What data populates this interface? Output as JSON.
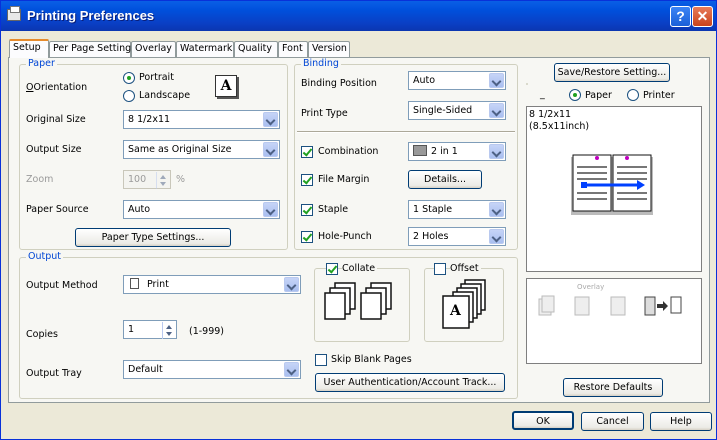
{
  "window": {
    "title": "Printing Preferences"
  },
  "tabs": [
    "Setup",
    "Per Page Setting",
    "Overlay",
    "Watermark",
    "Quality",
    "Font",
    "Version"
  ],
  "paper": {
    "legend": "Paper",
    "orientation_label": "Orientation",
    "portrait": "Portrait",
    "landscape": "Landscape",
    "orientation_icon": "A",
    "original_size_label": "Original Size",
    "original_size": "8 1/2x11",
    "output_size_label": "Output Size",
    "output_size": "Same as Original Size",
    "zoom_label": "Zoom",
    "zoom": "100",
    "zoom_unit": "%",
    "paper_source_label": "Paper Source",
    "paper_source": "Auto",
    "paper_type_button": "Paper Type Settings..."
  },
  "binding": {
    "legend": "Binding",
    "position_label": "Binding Position",
    "position": "Auto",
    "print_type_label": "Print Type",
    "print_type": "Single-Sided",
    "combination_label": "Combination",
    "combination": "2 in 1",
    "file_margin_label": "File Margin",
    "details_button": "Details...",
    "staple_label": "Staple",
    "staple": "1 Staple",
    "hole_punch_label": "Hole-Punch",
    "hole_punch": "2 Holes"
  },
  "output": {
    "legend": "Output",
    "method_label": "Output Method",
    "method": "Print",
    "copies_label": "Copies",
    "copies": "1",
    "copies_range": "(1-999)",
    "tray_label": "Output Tray",
    "tray": "Default",
    "collate_label": "Collate",
    "offset_label": "Offset",
    "skip_blank_label": "Skip Blank Pages",
    "user_auth_button": "User Authentication/Account Track...",
    "offset_icon": "A"
  },
  "right": {
    "save_restore_button": "Save/Restore Setting...",
    "dash": "_",
    "view_paper": "Paper",
    "view_printer": "Printer",
    "preview_size": "8 1/2x11",
    "preview_size_inch": "(8.5x11inch)",
    "overlay_text": "Overlay",
    "restore_defaults_button": "Restore Defaults"
  },
  "footer": {
    "ok": "OK",
    "cancel": "Cancel",
    "help": "Help"
  },
  "colors": {
    "title_bar": "#0a3fc4",
    "legend": "#0046d5",
    "check": "#21a121",
    "tab_highlight": "#e68b2c"
  }
}
